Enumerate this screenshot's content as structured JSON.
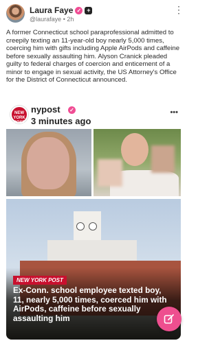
{
  "post": {
    "author_name": "Laura Faye",
    "handle": "@laurafaye",
    "separator": "•",
    "time": "2h",
    "text": "A former Connecticut school paraprofessional admitted to creepily texting an 11-year-old boy nearly 5,000 times, coercing him with gifts including Apple AirPods and caffeine before sexually assaulting him. Alyson Cranick pleaded guilty to federal charges of coercion and enticement of a minor to engage in sexual activity, the US Attorney's Office for the District of Connecticut announced."
  },
  "embed": {
    "source_name": "nypost",
    "logo_text": "NEW YORK POST",
    "time_ago": "3 minutes ago",
    "more_label": "•••",
    "source_tag": "NEW YORK POST",
    "headline": "Ex-Conn. school employee texted boy, 11, nearly 5,000 times, coerced him with AirPods, caffeine before sexually assaulting him"
  },
  "icons": {
    "verified": "check-badge-icon",
    "plus": "plus-badge-icon",
    "more": "more-vert-icon",
    "compose": "compose-icon"
  },
  "colors": {
    "accent_pink": "#ee4f8f",
    "nypost_red": "#c8102e"
  }
}
